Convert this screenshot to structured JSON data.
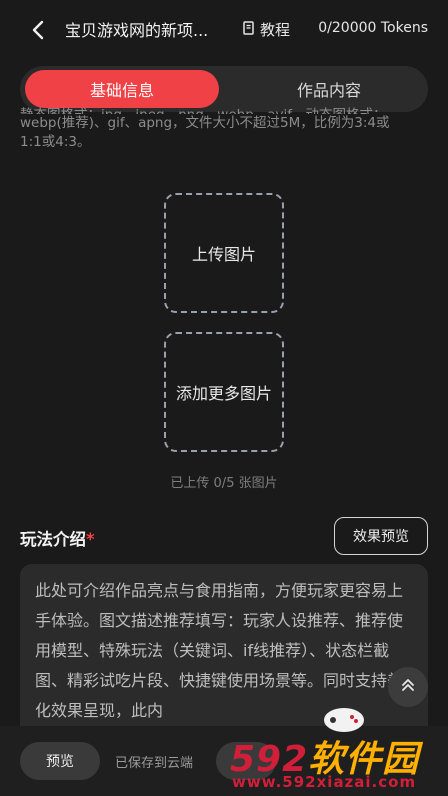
{
  "header": {
    "title": "宝贝游戏网的新项...",
    "tutorial_label": "教程",
    "tokens": "0/20000 Tokens"
  },
  "tabs": [
    {
      "label": "基础信息",
      "active": true
    },
    {
      "label": "作品内容",
      "active": false
    }
  ],
  "upload": {
    "hint_line1": "静态图格式：jpg、jpeg、png、webp、avif，动态图格式：",
    "hint_line2": "webp(推荐)、gif、apng，文件大小不超过5M，比例为3:4或",
    "hint_line3": "1:1或4:3。",
    "upload_label": "上传图片",
    "add_more_label": "添加更多图片",
    "count_text": "已上传 0/5 张图片"
  },
  "gameplay": {
    "title": "玩法介绍",
    "required_mark": "*",
    "preview_effect_label": "效果预览",
    "placeholder": "此处可介绍作品亮点与食用指南，方便玩家更容易上手体验。图文描述推荐填写：玩家人设推荐、推荐使用模型、特殊玩法（关键词、if线推荐）、状态栏截图、精彩试吃片段、快捷键使用场景等。同时支持美化效果呈现，此内"
  },
  "bottom": {
    "preview_label": "预览",
    "saved_text": "已保存到云端"
  },
  "watermark": {
    "num": "592",
    "cn": "软件园",
    "url": "www.592xiazai.com"
  },
  "colors": {
    "accent": "#f04146",
    "background": "#1a1a1a",
    "surface": "#2b2b2b"
  }
}
